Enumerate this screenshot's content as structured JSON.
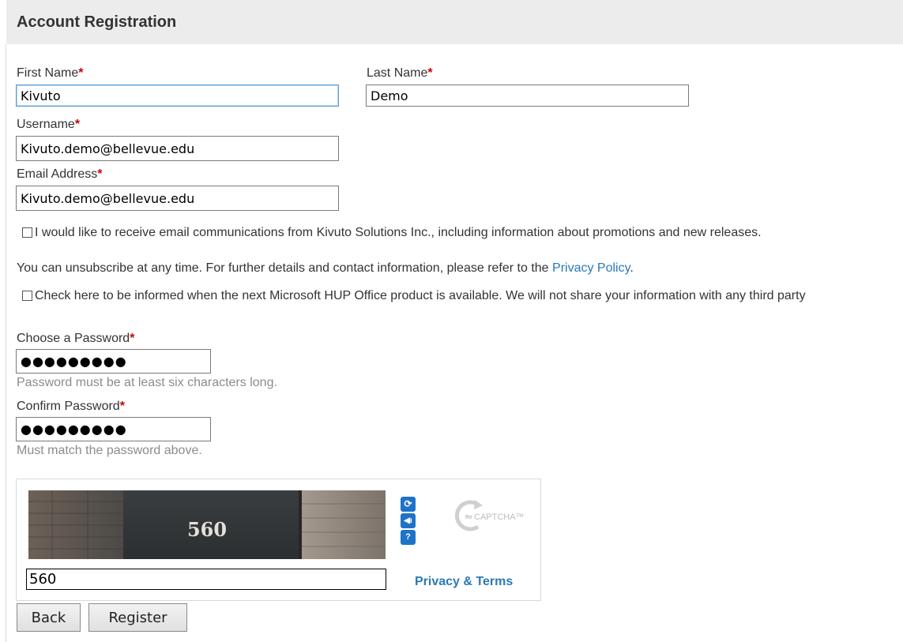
{
  "header": {
    "title": "Account Registration"
  },
  "form": {
    "first_name": {
      "label": "First Name",
      "required": "*",
      "value": "Kivuto"
    },
    "last_name": {
      "label": "Last Name",
      "required": "*",
      "value": "Demo"
    },
    "username": {
      "label": "Username",
      "required": "*",
      "value": "Kivuto.demo@bellevue.edu"
    },
    "email": {
      "label": "Email Address",
      "required": "*",
      "value": "Kivuto.demo@bellevue.edu"
    },
    "consent": {
      "line1": "I would like to receive email communications from Kivuto Solutions Inc., including information about promotions and new releases.",
      "line2": "You can unsubscribe at any time. For further details and contact information, please refer to the ",
      "link": "Privacy Policy",
      "line2_end": "."
    },
    "hup_notice": {
      "text": "Check here to be informed when the next Microsoft HUP Office product is available. We will not share your information with any third party"
    },
    "password": {
      "label": "Choose a Password",
      "required": "*",
      "value": "●●●●●●●●●",
      "hint": "Password must be at least six characters long."
    },
    "confirm_password": {
      "label": "Confirm Password",
      "required": "*",
      "value": "●●●●●●●●●",
      "hint": "Must match the password above."
    }
  },
  "captcha": {
    "image_text": "560",
    "input_value": "560",
    "privacy_link": "Privacy & Terms",
    "logo_text": "CAPTCHA™",
    "logo_prefix": "Re",
    "controls": [
      "refresh-icon",
      "audio-icon",
      "help-icon"
    ]
  },
  "buttons": {
    "back": "Back",
    "register": "Register"
  },
  "colors": {
    "link": "#2a7ab8",
    "required": "#cc0000",
    "header_bg": "#ececec",
    "focus_border": "#5b9bd5"
  }
}
